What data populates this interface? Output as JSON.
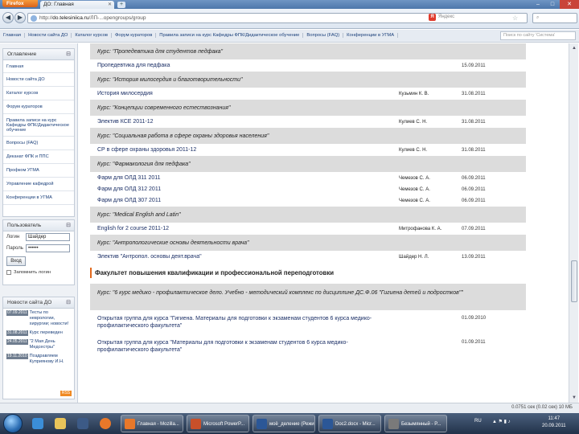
{
  "browser": {
    "button": "Firefox",
    "tab_title": "ДО: Главная",
    "url_prefix": "http://",
    "url_domain": "do.telesiniica.ru",
    "url_path": "/ЛП-...opengroups/group",
    "search_placeholder": "Яндекс"
  },
  "site_menu": {
    "items": [
      "Главная",
      "Новости сайта ДО",
      "Каталог курсов",
      "Форум кураторов",
      "Правила записи на курс Кафедры ФПК/Дидактическое обучение",
      "Вопросы (FAQ)",
      "Конференции в УГМА"
    ],
    "search_placeholder": "Поиск по сайту 'Система'"
  },
  "sidebar": {
    "nav_title": "Оглавление",
    "nav_items": [
      "Главная",
      "Новости сайта ДО",
      "Каталог курсов",
      "Форум кураторов",
      "Правила записи на курс Кафедры ФПК/Дидактическое обучение",
      "Вопросы (FAQ)",
      "Деканат ФПК и ППС",
      "Профком УГМА",
      "Управление кафедрой",
      "Конференции в УГМА"
    ],
    "login_title": "Пользователь",
    "login_label": "Логин",
    "login_value": "Шайдер",
    "password_label": "Пароль",
    "password_value": "••••••",
    "login_button": "Вход",
    "remember_label": "Запомнить логин",
    "news_title": "Новости сайта ДО",
    "news": [
      {
        "date": "07.09.2011",
        "text": "Тесты по неврологии, хирургии; новости!"
      },
      {
        "date": "31.08.2011",
        "text": "Курс переведен"
      },
      {
        "date": "24.05.2011",
        "text": "\"2 Мая День Медсестры\""
      },
      {
        "date": "19.11.2010",
        "text": "Поздравляем Куприянову И.Н."
      }
    ],
    "rss_label": "RSS"
  },
  "main": {
    "rows": [
      {
        "type": "course",
        "text": "Курс: \"Пропедевтика для студентов педфака\""
      },
      {
        "type": "item",
        "name": "Пропедевтика для педфака",
        "author": "",
        "date": "15.09.2011"
      },
      {
        "type": "course",
        "text": "Курс: \"История милосердия и благотворительности\""
      },
      {
        "type": "item",
        "name": "История милосердия",
        "author": "Кузьмин К. В.",
        "date": "31.08.2011"
      },
      {
        "type": "course",
        "text": "Курс: \"Концепции современного естествознания\""
      },
      {
        "type": "item",
        "name": "Электив КСЕ 2011-12",
        "author": "Кулиев С. Н.",
        "date": "31.08.2011"
      },
      {
        "type": "course",
        "text": "Курс: \"Социальная работа в сфере охраны здоровья населения\""
      },
      {
        "type": "item",
        "name": "СР в сфере охраны здоровья 2011-12",
        "author": "Кулиев С. Н.",
        "date": "31.08.2011"
      },
      {
        "type": "course",
        "text": "Курс: \"Фармакология для педфака\""
      },
      {
        "type": "item",
        "name": "Фарм для ОЛД 311 2011",
        "author": "Чемезов С. А.",
        "date": "06.09.2011"
      },
      {
        "type": "item",
        "name": "Фарм для ОЛД 312 2011",
        "author": "Чемезов С. А.",
        "date": "06.09.2011"
      },
      {
        "type": "item",
        "name": "Фарм для ОЛД 307 2011",
        "author": "Чемезов С. А.",
        "date": "06.09.2011"
      },
      {
        "type": "course",
        "text": "Курс: \"Medical English and Latin\""
      },
      {
        "type": "item",
        "name": "English for 2 course 2011-12",
        "author": "Митрофанова К. А.",
        "date": "07.09.2011"
      },
      {
        "type": "course",
        "text": "Курс: \"Антропологические основы деятельности врача\""
      },
      {
        "type": "item",
        "name": "Электив \"Антропол. основы деят.врача\"",
        "author": "Шайдер Н. Л.",
        "date": "13.09.2011"
      }
    ],
    "faculty_title": "Факультет повышения квалификации и профессиональной переподготовки",
    "faculty_course": "Курс: \"6 курс медико - профилактическое дело. Учебно - методический комплекс по дисциплине ДС.Ф.06 \"Гигиена детей и подростков\"\"",
    "faculty_items": [
      {
        "name": "Открытая группа для курса \"Гигиена. Материалы для подготовки к экзаменам студентов 6 курса медико-профилактического факультета\"",
        "date": "01.09.2010"
      },
      {
        "name": "Открытая группа для курса \"Материалы для подготовки к экзаменам студентов 6 курса медико-профилактического факультета\"",
        "date": "01.09.2011"
      }
    ]
  },
  "status": {
    "text": "0.0751 сек (0.02 сек) 10 МБ"
  },
  "taskbar": {
    "tasks": [
      "Главная - Mozilla...",
      "Microsoft PowerP...",
      "моё_деление (Режим...",
      "Doc2.docx - Micr...",
      "Безымянный - P..."
    ],
    "tray_lang": "RU",
    "time": "11:47",
    "date": "20.09.2011"
  },
  "colors": {
    "course_row_bg": "#dcdcdc",
    "link": "#1b2f66",
    "faculty_accent": "#e26a1e"
  }
}
